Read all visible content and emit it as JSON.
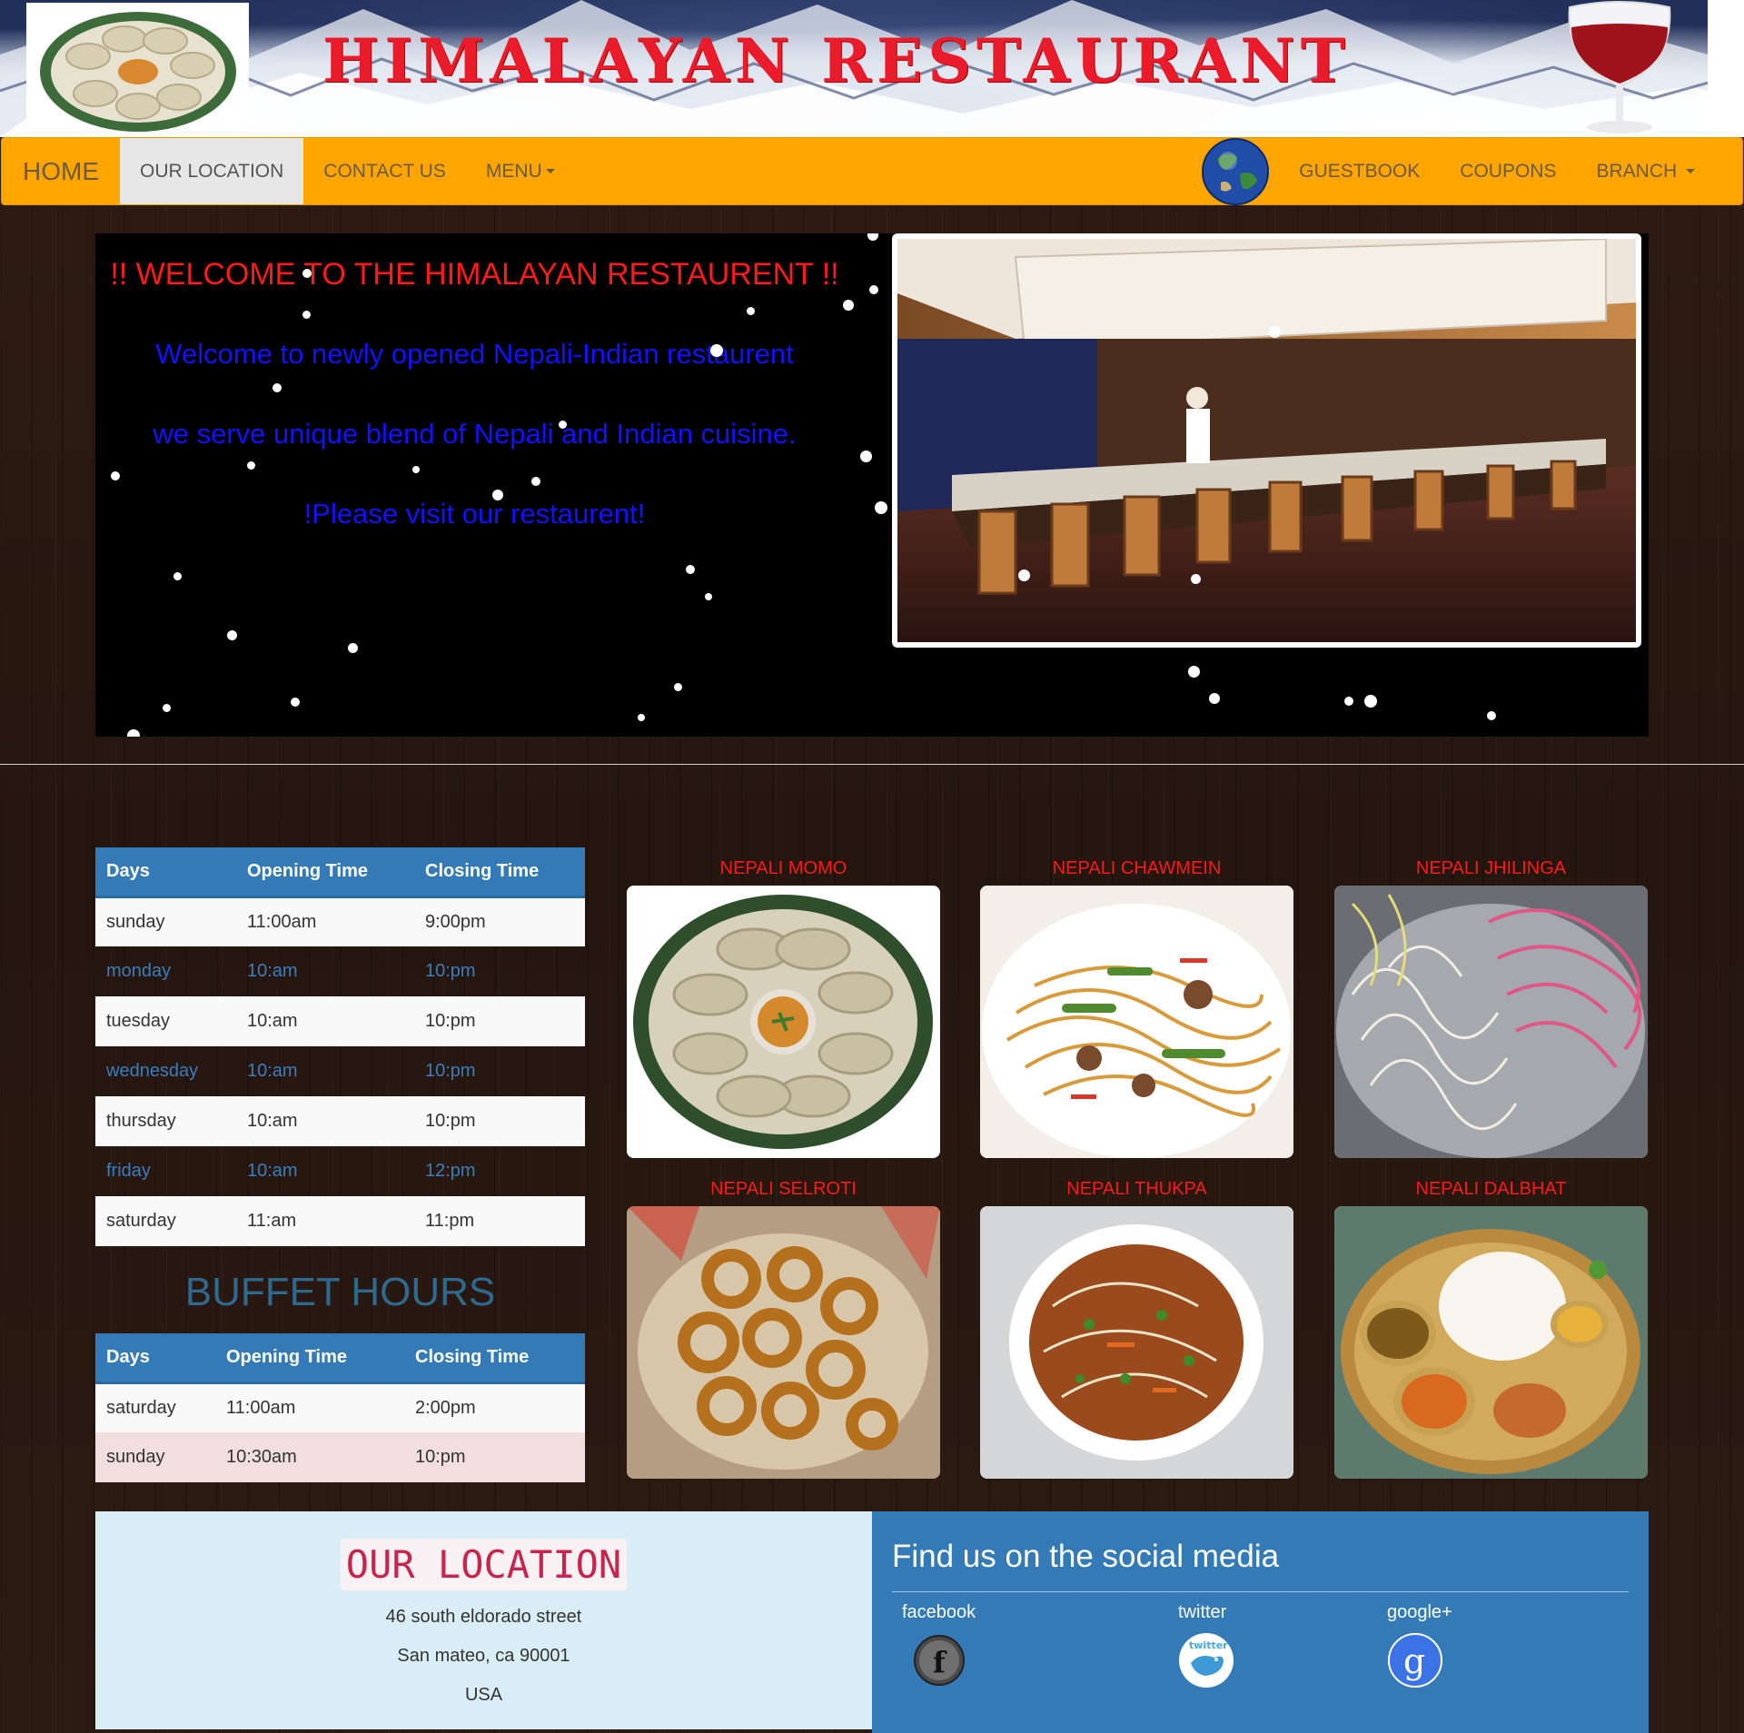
{
  "banner": {
    "title": "HIMALAYAN RESTAURANT"
  },
  "nav": {
    "brand": "HOME",
    "left_items": [
      "OUR LOCATION",
      "CONTACT US",
      "MENU"
    ],
    "right_items": [
      "GUESTBOOK",
      "COUPONS",
      "BRANCH"
    ],
    "active": "OUR LOCATION",
    "colors": {
      "bar": "#ffa500",
      "active_bg": "#e7e7e7"
    }
  },
  "welcome": {
    "headline": "!! WELCOME TO THE HIMALAYAN RESTAURENT !!",
    "line1": "Welcome to newly opened Nepali-Indian restaurent",
    "line2": "we serve unique blend of Nepali and Indian cuisine.",
    "line3": "!Please visit our restaurent!"
  },
  "hours_table": {
    "headers": [
      "Days",
      "Opening Time",
      "Closing Time"
    ],
    "rows": [
      [
        "sunday",
        "11:00am",
        "9:00pm"
      ],
      [
        "monday",
        "10:am",
        "10:pm"
      ],
      [
        "tuesday",
        "10:am",
        "10:pm"
      ],
      [
        "wednesday",
        "10:am",
        "10:pm"
      ],
      [
        "thursday",
        "10:am",
        "10:pm"
      ],
      [
        "friday",
        "10:am",
        "12:pm"
      ],
      [
        "saturday",
        "11:am",
        "11:pm"
      ]
    ]
  },
  "buffet": {
    "title": "BUFFET HOURS",
    "headers": [
      "Days",
      "Opening Time",
      "Closing Time"
    ],
    "rows": [
      [
        "saturday",
        "11:00am",
        "2:00pm"
      ],
      [
        "sunday",
        "10:30am",
        "10:pm"
      ]
    ]
  },
  "foods": [
    "NEPALI MOMO",
    "NEPALI CHAWMEIN",
    "NEPALI JHILINGA",
    "NEPALI SELROTI",
    "NEPALI THUKPA",
    "NEPALI DALBHAT"
  ],
  "location": {
    "title": "OUR LOCATION",
    "street": "46 south eldorado street",
    "city": "San mateo, ca 90001",
    "country": "USA"
  },
  "social": {
    "title": "Find us on the social media",
    "facebook": "facebook",
    "twitter": "twitter",
    "google": "google+",
    "twitter_logo_text": "twitter"
  }
}
